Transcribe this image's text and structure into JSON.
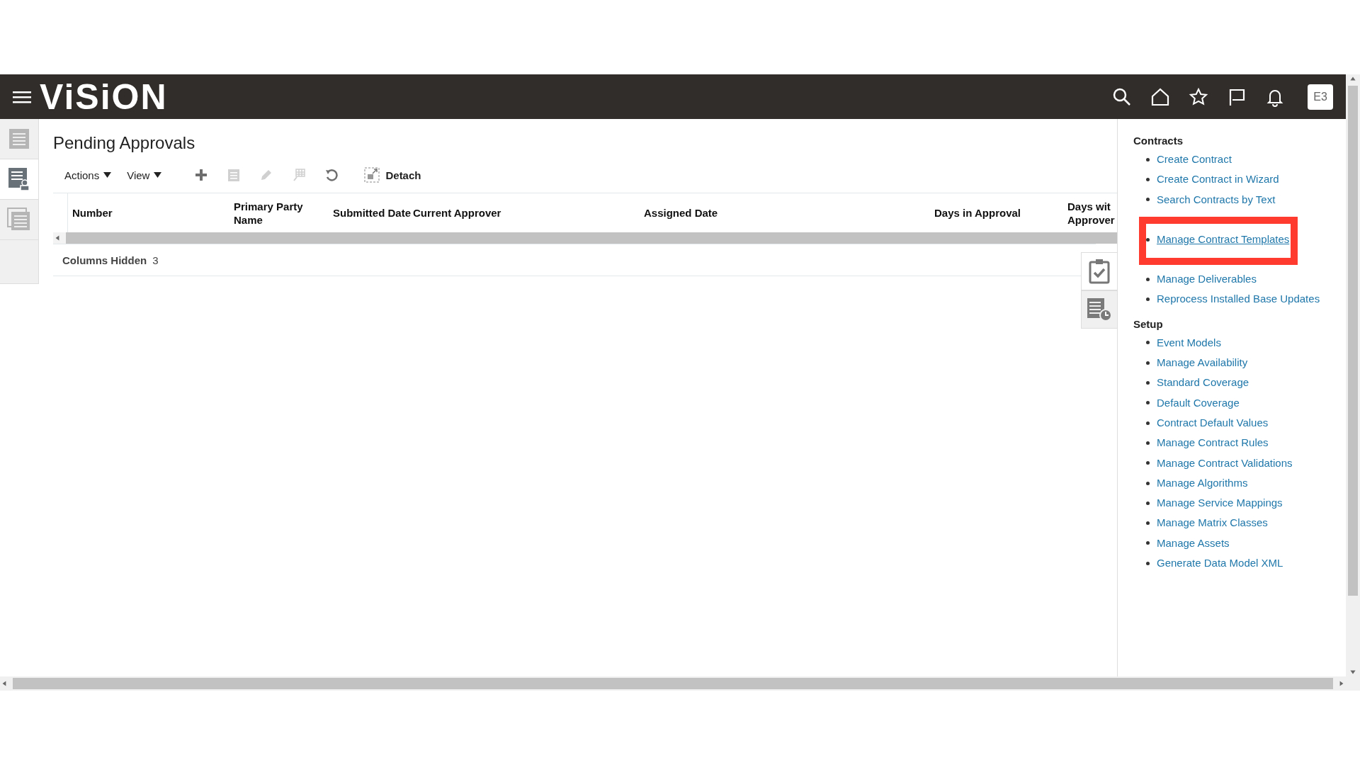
{
  "header": {
    "logo": "ViSiON",
    "user_badge": "E3"
  },
  "left_rail": [
    {
      "selected": false
    },
    {
      "selected": true
    },
    {
      "selected": false
    }
  ],
  "page_title": "Pending Approvals",
  "toolbar": {
    "menus": [
      "Actions",
      "View"
    ],
    "tools": [
      {
        "kind": "add",
        "disabled": false
      },
      {
        "kind": "copy",
        "disabled": true
      },
      {
        "kind": "edit",
        "disabled": true
      },
      {
        "kind": "grid",
        "disabled": true
      },
      {
        "kind": "refresh",
        "disabled": false
      }
    ],
    "detach": "Detach"
  },
  "table": {
    "columns": [
      "Number",
      "Primary Party Name",
      "Submitted Date",
      "Current Approver",
      "Assigned Date",
      "Days in Approval",
      "Days wit Approver"
    ]
  },
  "columns_hidden": {
    "label": "Columns Hidden",
    "count": "3"
  },
  "side_tabs": [
    {
      "kind": "checklist",
      "selected": true
    },
    {
      "kind": "schedule",
      "selected": false
    }
  ],
  "task_panel": [
    {
      "title": "Contracts",
      "items": [
        {
          "label": "Create Contract",
          "highlighted": false
        },
        {
          "label": "Create Contract in Wizard",
          "highlighted": false
        },
        {
          "label": "Search Contracts by Text",
          "highlighted": false
        },
        {
          "label": "Manage Contract Templates",
          "highlighted": true
        },
        {
          "label": "Manage Deliverables",
          "highlighted": false
        },
        {
          "label": "Reprocess Installed Base Updates",
          "highlighted": false
        }
      ]
    },
    {
      "title": "Setup",
      "items": [
        {
          "label": "Event Models",
          "highlighted": false
        },
        {
          "label": "Manage Availability",
          "highlighted": false
        },
        {
          "label": "Standard Coverage",
          "highlighted": false
        },
        {
          "label": "Default Coverage",
          "highlighted": false
        },
        {
          "label": "Contract Default Values",
          "highlighted": false
        },
        {
          "label": "Manage Contract Rules",
          "highlighted": false
        },
        {
          "label": "Manage Contract Validations",
          "highlighted": false
        },
        {
          "label": "Manage Algorithms",
          "highlighted": false
        },
        {
          "label": "Manage Service Mappings",
          "highlighted": false
        },
        {
          "label": "Manage Matrix Classes",
          "highlighted": false
        },
        {
          "label": "Manage Assets",
          "highlighted": false
        },
        {
          "label": "Generate Data Model XML",
          "highlighted": false
        }
      ]
    }
  ]
}
